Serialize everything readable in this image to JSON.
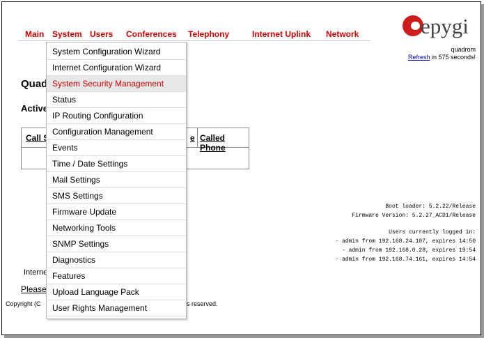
{
  "nav": {
    "items": [
      "Main",
      "System",
      "Users",
      "Conferences",
      "Telephony",
      "Internet Uplink",
      "Network"
    ]
  },
  "logo": {
    "text": "epygi"
  },
  "header": {
    "subtitle": "quadrom",
    "refresh_link": "Refresh",
    "refresh_suffix": " in 575 seconds!"
  },
  "page": {
    "title_visible": "Quad",
    "section_visible": "Active"
  },
  "table": {
    "header_left": "Call S",
    "header_mid": "e",
    "header_right": "Called Phone"
  },
  "info": {
    "boot_loader": "Boot loader: 5.2.22/Release",
    "firmware": "Firmware Version: 5.2.27_ACD1/Release",
    "users_heading": "Users currently logged in:",
    "users": [
      "- admin from 192.168.24.107, expires 14:50",
      "- admin from 192.168.0.28, expires 19:54",
      "- admin from 192.168.74.161, expires 14:54"
    ]
  },
  "footer": {
    "internet_fragment": "Interne",
    "please_fragment": "Please",
    "copyright_fragment": "Copyright (C",
    "rights_fragment": "s reserved."
  },
  "dropdown": {
    "active_index": 2,
    "items": [
      "System Configuration Wizard",
      "Internet Configuration Wizard",
      "System Security Management",
      "Status",
      "IP Routing Configuration",
      "Configuration Management",
      "Events",
      "Time / Date Settings",
      "Mail Settings",
      "SMS Settings",
      "Firmware Update",
      "Networking Tools",
      "SNMP Settings",
      "Diagnostics",
      "Features",
      "Upload Language Pack",
      "User Rights Management"
    ]
  }
}
